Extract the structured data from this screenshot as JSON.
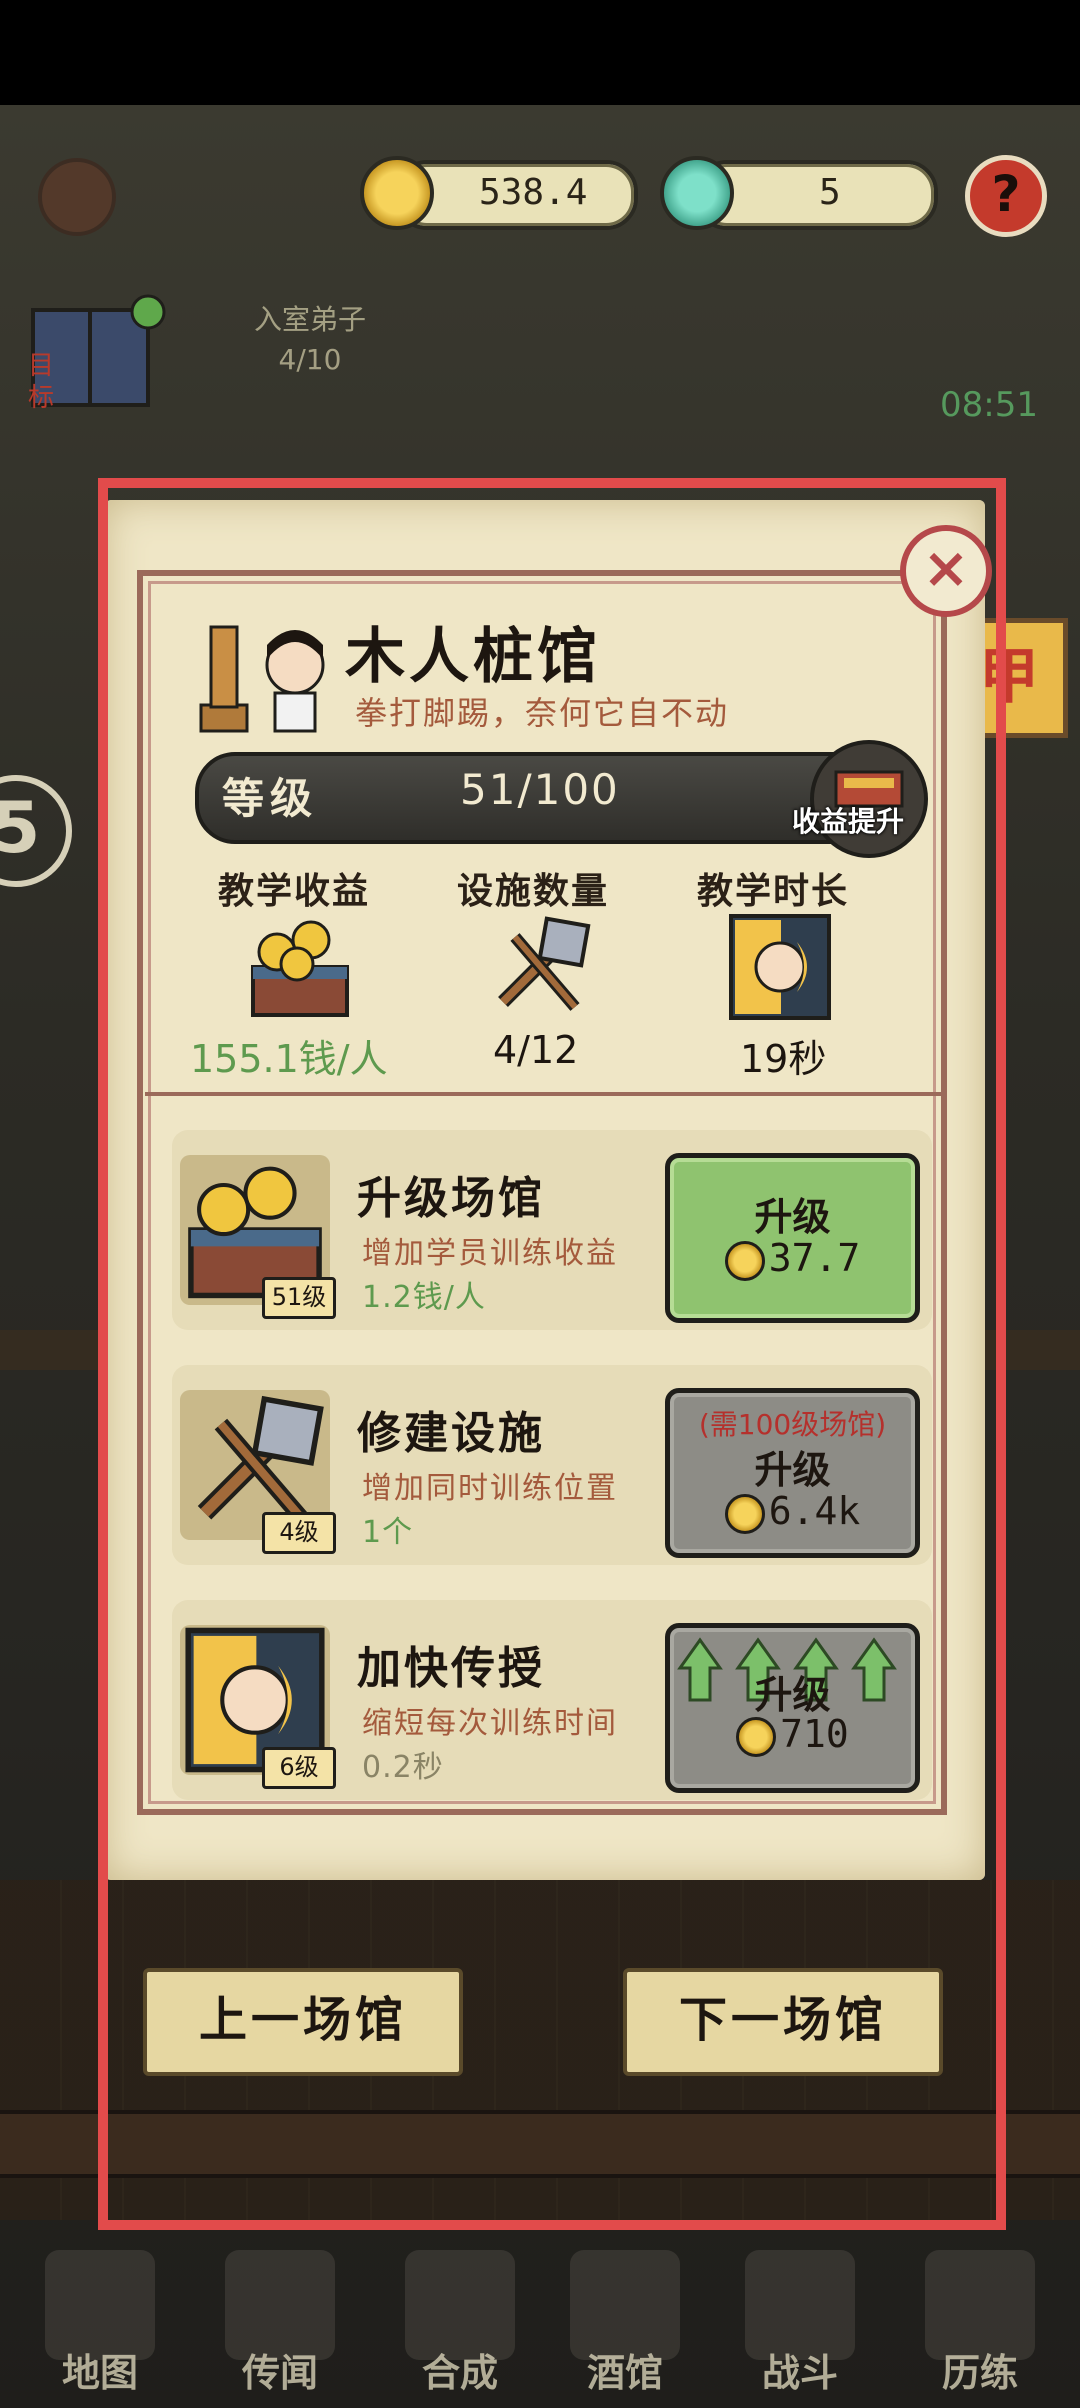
{
  "currency": {
    "coins": "538.4",
    "jade": "5"
  },
  "top": {
    "help_label": "?",
    "quest_label": "目标",
    "disciple_title": "入室弟子",
    "disciple_count": "4/10",
    "timer": "08:51"
  },
  "dialog": {
    "close_label": "×",
    "side_tab_label": "甲",
    "title": "木人桩馆",
    "subtitle": "拳打脚踢，奈何它自不动",
    "level_label": "等级",
    "level_value": "51/100",
    "boost_label": "收益提升",
    "stats": [
      {
        "label": "教学收益",
        "value": "155.1钱/人",
        "icon": "coin-chest-icon"
      },
      {
        "label": "设施数量",
        "value": "4/12",
        "icon": "hammer-icon"
      },
      {
        "label": "教学时长",
        "value": "19秒",
        "icon": "sun-moon-card-icon"
      }
    ],
    "upgrades": [
      {
        "title": "升级场馆",
        "desc": "增加学员训练收益",
        "amount": "1.2钱/人",
        "badge": "51级",
        "button_label": "升级",
        "cost": "37.7",
        "icon": "coin-chest-icon"
      },
      {
        "title": "修建设施",
        "desc": "增加同时训练位置",
        "amount": "1个",
        "badge": "4级",
        "requirement": "(需100级场馆)",
        "button_label": "升级",
        "cost": "6.4k",
        "icon": "hammer-icon"
      },
      {
        "title": "加快传授",
        "desc": "缩短每次训练时间",
        "amount": "0.2秒",
        "badge": "6级",
        "button_label": "升级",
        "cost": "710",
        "icon": "sun-moon-card-icon"
      }
    ],
    "prev_label": "上一场馆",
    "next_label": "下一场馆"
  },
  "side": {
    "left_badge": "5"
  },
  "bottom_nav": [
    {
      "label": "地图",
      "icon": "map-icon"
    },
    {
      "label": "传闻",
      "icon": "scroll-icon"
    },
    {
      "label": "合成",
      "icon": "book-icon"
    },
    {
      "label": "酒馆",
      "icon": "tavern-icon"
    },
    {
      "label": "战斗",
      "icon": "swords-icon"
    },
    {
      "label": "历练",
      "icon": "demon-mask-icon"
    }
  ],
  "colors": {
    "highlight": "#e24b4b",
    "green_button": "#8fc36f",
    "gray_button": "#8d8c86",
    "accent_text": "#a45a3c",
    "value_green": "#5e9a4e"
  }
}
